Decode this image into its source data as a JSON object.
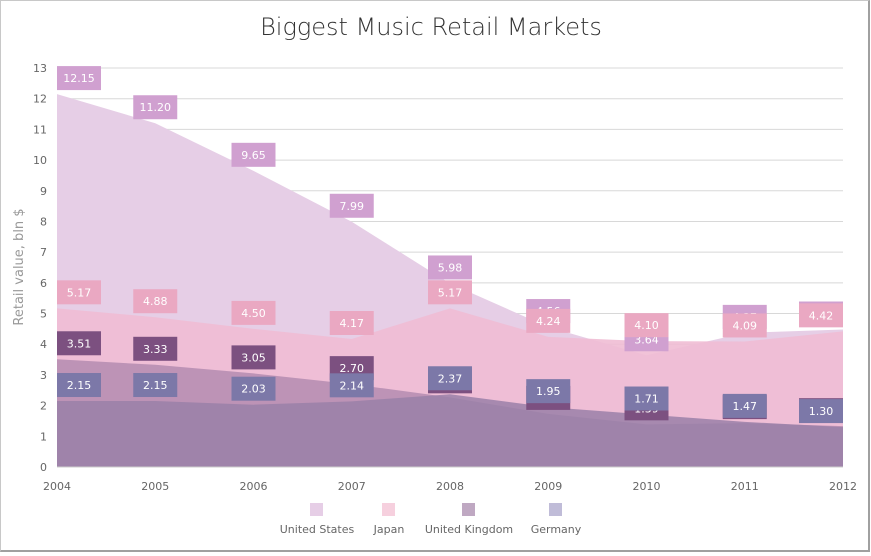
{
  "chart_data": {
    "type": "area",
    "title": "Biggest Music Retail Markets",
    "xlabel": "",
    "ylabel": "Retail value, bln $",
    "x": [
      "2004",
      "2005",
      "2006",
      "2007",
      "2008",
      "2009",
      "2010",
      "2011",
      "2012"
    ],
    "ylim": [
      0,
      13
    ],
    "yticks": [
      "0",
      "1",
      "2",
      "3",
      "4",
      "5",
      "6",
      "7",
      "8",
      "9",
      "10",
      "11",
      "12",
      "13"
    ],
    "grid": true,
    "legend_position": "bottom",
    "series": [
      {
        "name": "United States",
        "color": "#e6cee6",
        "label_color": "#d0a0d0",
        "values": [
          12.15,
          11.2,
          9.65,
          7.99,
          5.98,
          4.56,
          3.64,
          4.37,
          4.48
        ],
        "label_text": [
          "12.15",
          "11.20",
          "9.65",
          "7.99",
          "5.98",
          "4.56",
          "3.64",
          "4.37",
          "4.48"
        ]
      },
      {
        "name": "Japan",
        "color": "#f0bcd4",
        "label_color": "#eaa8c2",
        "values": [
          5.17,
          4.88,
          4.5,
          4.17,
          5.17,
          4.24,
          4.1,
          4.09,
          4.42
        ],
        "label_text": [
          "5.17",
          "4.88",
          "4.50",
          "4.17",
          "5.17",
          "4.24",
          "4.10",
          "4.09",
          "4.42"
        ]
      },
      {
        "name": "United Kingdom",
        "color": "#b48cb0",
        "label_color": "#7c5080",
        "values": [
          3.51,
          3.33,
          3.05,
          2.7,
          2.27,
          1.73,
          1.39,
          1.43,
          1.33
        ],
        "label_text": [
          "3.51",
          "3.33",
          "3.05",
          "2.70",
          "2.27",
          "1.73",
          "1.39",
          "1.43",
          "1.33"
        ]
      },
      {
        "name": "Germany",
        "color": "#9a80a8",
        "label_color": "#7c78a8",
        "values": [
          2.15,
          2.15,
          2.03,
          2.14,
          2.37,
          1.95,
          1.71,
          1.47,
          1.3
        ],
        "label_text": [
          "2.15",
          "2.15",
          "2.03",
          "2.14",
          "2.37",
          "1.95",
          "1.71",
          "1.47",
          "1.30"
        ]
      }
    ],
    "legend_swatches": [
      "#e6cee6",
      "#f6d0de",
      "#bfa8c2",
      "#c0bcd8"
    ]
  }
}
